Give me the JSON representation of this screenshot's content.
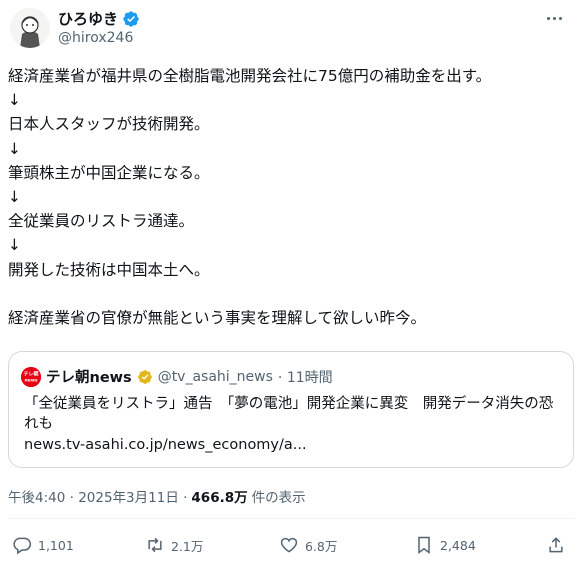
{
  "author": {
    "display_name": "ひろゆき",
    "handle": "@hirox246"
  },
  "tweet": {
    "text": "経済産業省が福井県の全樹脂電池開発会社に75億円の補助金を出す。\n↓\n日本人スタッフが技術開発。\n↓\n筆頭株主が中国企業になる。\n↓\n全従業員のリストラ通達。\n↓\n開発した技術は中国本土へ。\n\n経済産業省の官僚が無能という事実を理解して欲しい昨今。"
  },
  "quote": {
    "logo_text": "テレ朝news",
    "name": "テレ朝news",
    "handle": "@tv_asahi_news",
    "time": "· 11時間",
    "text": "「全従業員をリストラ」通告　「夢の電池」開発企業に異変　開発データ消失の恐れも",
    "url": "news.tv-asahi.co.jp/news_economy/a..."
  },
  "meta": {
    "timestamp": "午後4:40 · 2025年3月11日 ·",
    "views": "466.8万",
    "views_label": "件の表示"
  },
  "actions": {
    "replies": "1,101",
    "retweets": "2.1万",
    "likes": "6.8万",
    "bookmarks": "2,484"
  },
  "colors": {
    "verified_blue": "#1d9bf0",
    "verified_gold": "#e2b719",
    "muted": "#536471"
  }
}
